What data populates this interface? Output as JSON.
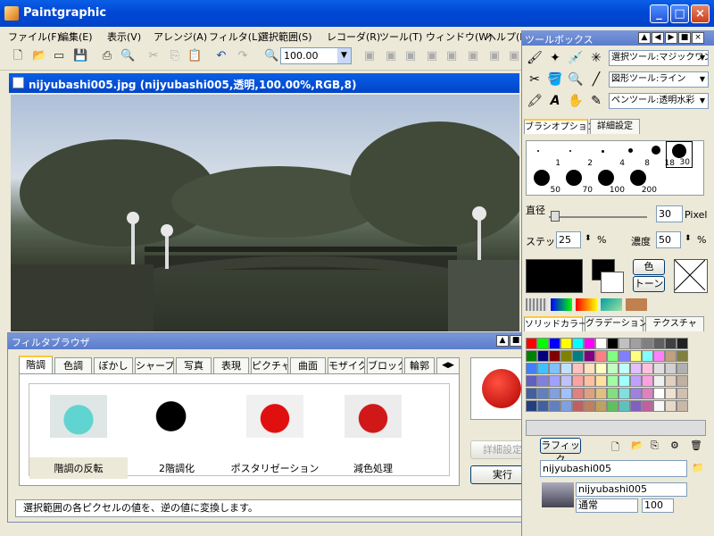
{
  "app": {
    "title": "Paintgraphic",
    "min": "_",
    "max": "□",
    "close": "×"
  },
  "menu": [
    "ファイル(F)",
    "編集(E)",
    "表示(V)",
    "アレンジ(A)",
    "フィルタ(L)",
    "選択範囲(S)",
    "レコーダ(R)",
    "ツール(T)",
    "ウィンドウ(W)",
    "ヘルプ(H)"
  ],
  "toolbar": {
    "zoom": "100.00"
  },
  "document": {
    "title": "nijyubashi005.jpg (nijyubashi005,透明,100.00%,RGB,8)"
  },
  "filter_browser": {
    "title": "フィルタブラウザ",
    "tabs": [
      "階調",
      "色調",
      "ぼかし",
      "シャープ",
      "写真",
      "表現",
      "ピクチャ",
      "曲面",
      "モザイク",
      "ブロック",
      "輪郭"
    ],
    "items": [
      {
        "label": "階調の反転",
        "selected": true
      },
      {
        "label": "2階調化",
        "selected": false
      },
      {
        "label": "ポスタリゼーション",
        "selected": false
      },
      {
        "label": "減色処理",
        "selected": false
      }
    ],
    "detail_button": "詳細設定",
    "run_button": "実行",
    "status": "選択範囲の各ピクセルの値を、逆の値に変換します。"
  },
  "toolbox": {
    "title": "ツールボックス",
    "select_tool": "選択ツール:マジックワンド",
    "shape_tool": "図形ツール:ライン",
    "pen_tool": "ペンツール:透明水彩",
    "tabs": {
      "brush_option": "ブラシオプション",
      "detail": "詳細設定"
    },
    "brushes": [
      "1",
      "2",
      "4",
      "8",
      "18",
      "30",
      "50",
      "70",
      "100",
      "200"
    ],
    "diameter_label": "直径",
    "diameter_value": "30",
    "diameter_unit": "Pixel",
    "step_label": "ステップ",
    "step_value": "25",
    "step_unit": "%",
    "density_label": "濃度",
    "density_value": "50",
    "density_unit": "%",
    "color_btn": "色",
    "tone_btn": "トーン",
    "color_tabs": [
      "ソリッドカラー",
      "グラデーション",
      "テクスチャ"
    ],
    "layer_mode": "ラフィック",
    "layer_file": "nijyubashi005",
    "layer_name": "nijyubashi005",
    "blend": "通常",
    "opacity": "100"
  },
  "colors": {
    "titlebar": "#0050d8",
    "palette_row1": [
      "#ff0000",
      "#00ff00",
      "#0000ff",
      "#ffff00",
      "#00ffff",
      "#ff00ff",
      "#ffffff",
      "#000000",
      "#c0c0c0",
      "#a0a0a0",
      "#808080",
      "#606060",
      "#404040",
      "#202020"
    ]
  }
}
